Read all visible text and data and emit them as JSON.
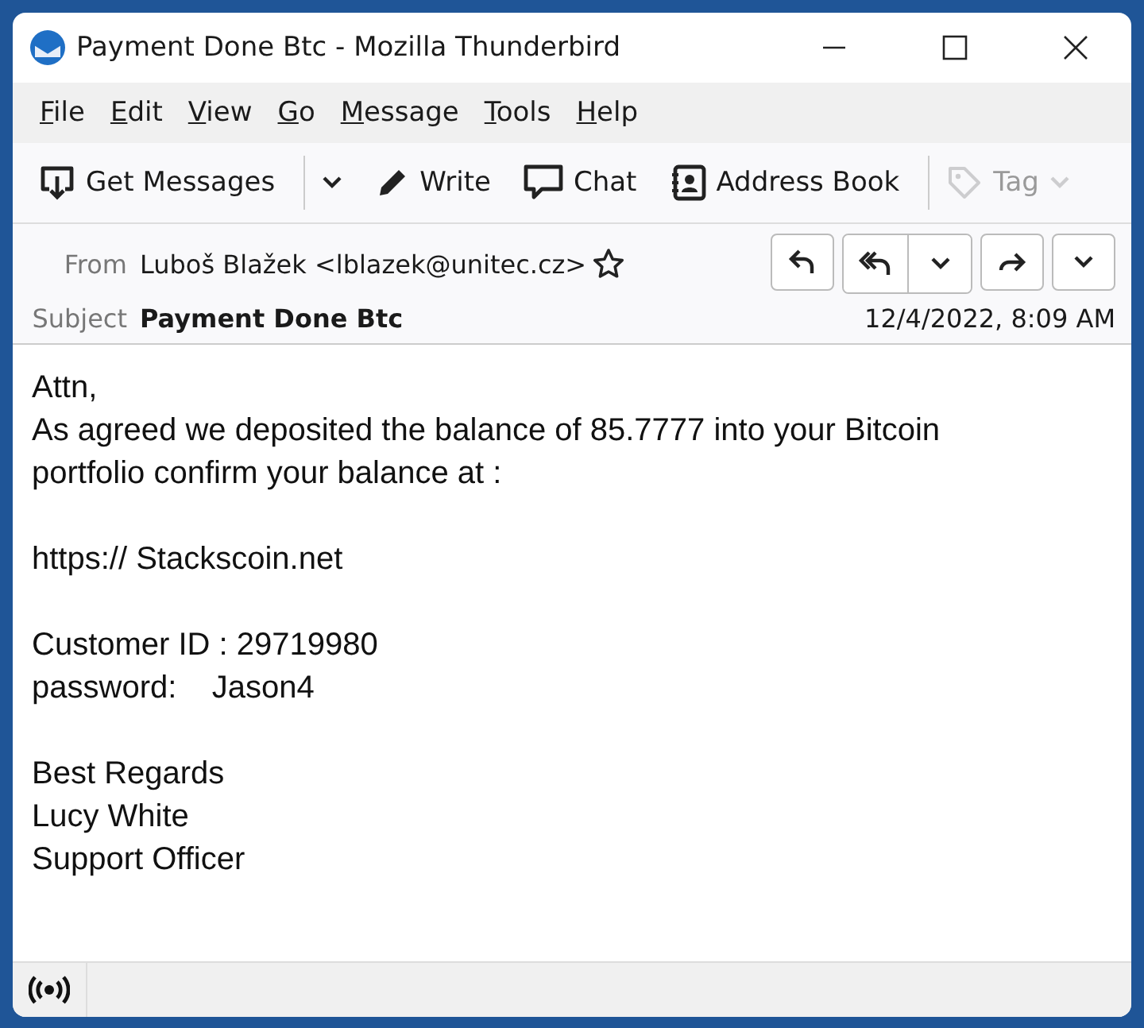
{
  "window": {
    "title": "Payment Done Btc - Mozilla Thunderbird"
  },
  "menu": [
    "File",
    "Edit",
    "View",
    "Go",
    "Message",
    "Tools",
    "Help"
  ],
  "toolbar": [
    {
      "kind": "get",
      "label": "Get Messages",
      "disabled": false
    },
    {
      "kind": "dropdown",
      "disabled": false
    },
    {
      "kind": "write",
      "label": "Write",
      "disabled": false
    },
    {
      "kind": "chat",
      "label": "Chat",
      "disabled": false
    },
    {
      "kind": "addressbook",
      "label": "Address Book",
      "disabled": false
    },
    {
      "kind": "tag",
      "label": "Tag",
      "disabled": true
    }
  ],
  "header": {
    "from_label": "From",
    "from": "Luboš Blažek <lblazek@unitec.cz>",
    "subject_label": "Subject",
    "subject": "Payment Done Btc",
    "date": "12/4/2022, 8:09 AM"
  },
  "body": [
    [
      "Attn,",
      "As agreed we deposited the balance of 85.7777 into your Bitcoin",
      "portfolio confirm your balance at :"
    ],
    [
      "https:// Stackscoin.net"
    ],
    [
      "Customer ID : 29719980",
      "password:    Jason4"
    ],
    [
      "Best Regards",
      "Lucy White",
      "Support Officer"
    ]
  ]
}
